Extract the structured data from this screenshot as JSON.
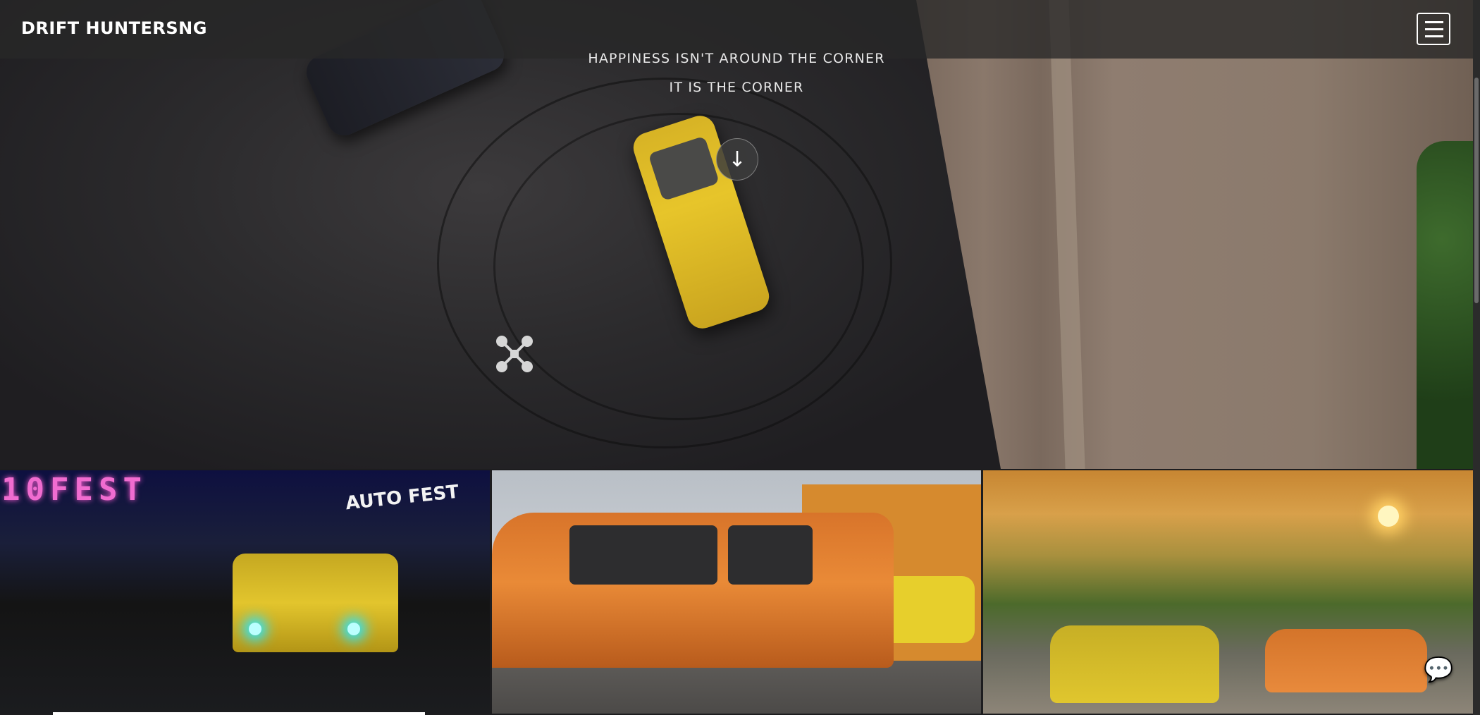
{
  "header": {
    "brand": "DRIFT HUNTERSNG"
  },
  "hero": {
    "tagline_1": "HAPPINESS ISN'T AROUND THE CORNER",
    "tagline_2": "IT IS THE CORNER",
    "scroll_arrow": "↓"
  },
  "gallery": {
    "tile1": {
      "sign_text": "10FEST",
      "event_logo": "AUTO FEST"
    },
    "tile2": {
      "subject": "orange car on jacks"
    },
    "tile3": {
      "subject": "yellow and orange cars at sunset"
    }
  },
  "icons": {
    "menu": "hamburger-icon",
    "scroll": "arrow-down-icon",
    "chat": "chat-icon"
  },
  "colors": {
    "header_bg": "#282828",
    "text_primary": "#ffffff"
  }
}
